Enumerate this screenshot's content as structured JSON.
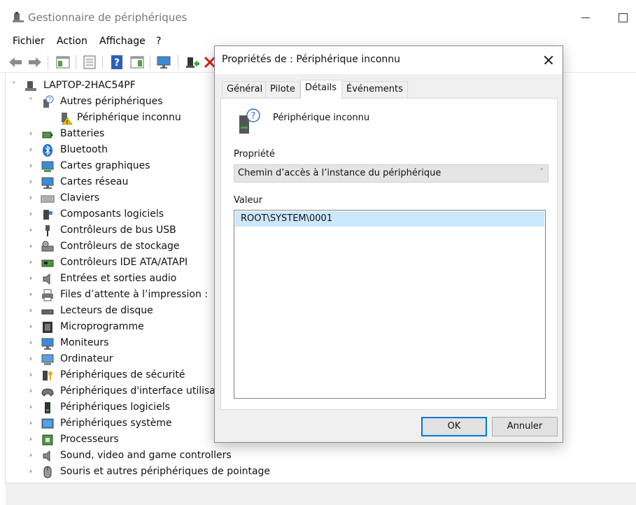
{
  "window": {
    "title": "Gestionnaire de périphériques",
    "icon": "device-manager-icon"
  },
  "menu": [
    "Fichier",
    "Action",
    "Affichage",
    "?"
  ],
  "toolbar": {
    "buttons": [
      "back-icon",
      "forward-icon",
      "properties-icon",
      "details-icon",
      "help-icon",
      "action-pane-icon",
      "monitor-icon",
      "update-driver-icon",
      "uninstall-icon"
    ]
  },
  "tree": {
    "root": "LAPTOP-2HAC54PF",
    "expanded_category": "Autres périphériques",
    "expanded_child": "Périphérique inconnu",
    "categories": [
      "Batteries",
      "Bluetooth",
      "Cartes graphiques",
      "Cartes réseau",
      "Claviers",
      "Composants logiciels",
      "Contrôleurs de bus USB",
      "Contrôleurs de stockage",
      "Contrôleurs IDE ATA/ATAPI",
      "Entrées et sorties audio",
      "Files d’attente à l’impression :",
      "Lecteurs de disque",
      "Microprogramme",
      "Moniteurs",
      "Ordinateur",
      "Périphériques de sécurité",
      "Périphériques d'interface utilisateur",
      "Périphériques logiciels",
      "Périphériques système",
      "Processeurs",
      "Sound, video and game controllers",
      "Souris et autres périphériques de pointage"
    ]
  },
  "dialog": {
    "title": "Propriétés de : Périphérique inconnu",
    "tabs": [
      "Général",
      "Pilote",
      "Détails",
      "Événements"
    ],
    "active_tab": "Détails",
    "device_name": "Périphérique inconnu",
    "property_label": "Propriété",
    "property_value": "Chemin d’accès à l’instance du périphérique",
    "value_label": "Valeur",
    "values": [
      "ROOT\\SYSTEM\\0001"
    ],
    "ok_label": "OK",
    "cancel_label": "Annuler"
  },
  "colors": {
    "selection": "#cce8ff",
    "accent": "#0078d7",
    "dialog_bg": "#f0f0f0"
  }
}
